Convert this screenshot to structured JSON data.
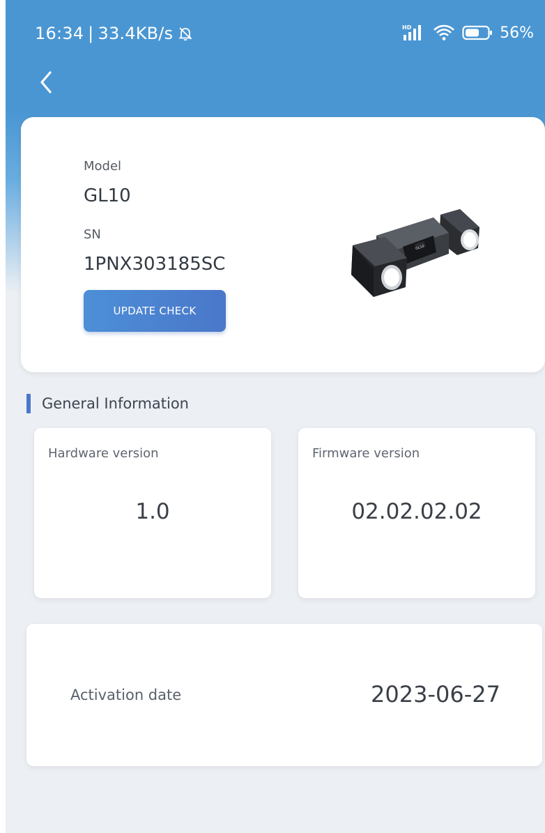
{
  "status_bar": {
    "time": "16:34",
    "separator": "|",
    "net_speed": "33.4KB/s",
    "signal_badge": "HD",
    "battery": "56%"
  },
  "icons": {
    "back": "chevron-left-icon",
    "mute": "bell-off-icon",
    "signal": "cellular-signal-icon",
    "wifi": "wifi-icon",
    "battery": "battery-icon"
  },
  "device": {
    "model_label": "Model",
    "model_value": "GL10",
    "sn_label": "SN",
    "sn_value": "1PNX303185SC",
    "update_button": "UPDATE CHECK",
    "image_badge": "GL10"
  },
  "general": {
    "title": "General Information",
    "hardware_label": "Hardware version",
    "hardware_value": "1.0",
    "firmware_label": "Firmware version",
    "firmware_value": "02.02.02.02"
  },
  "activation": {
    "label": "Activation date",
    "value": "2023-06-27"
  },
  "colors": {
    "header_blue": "#4a96d3",
    "button_blue": "#4a77c9",
    "background": "#eceff4",
    "card": "#ffffff"
  }
}
